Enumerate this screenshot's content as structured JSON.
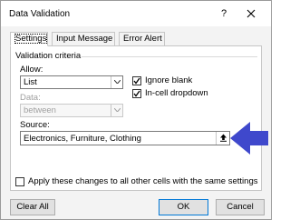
{
  "window": {
    "title": "Data Validation",
    "help_label": "?",
    "close_icon": "close-icon"
  },
  "tabs": [
    {
      "label": "Settings",
      "selected": true
    },
    {
      "label": "Input Message",
      "selected": false
    },
    {
      "label": "Error Alert",
      "selected": false
    }
  ],
  "criteria": {
    "section_label": "Validation criteria",
    "allow_label": "Allow:",
    "allow_value": "List",
    "data_label": "Data:",
    "data_value": "between",
    "data_enabled": false,
    "ignore_blank_label": "Ignore blank",
    "ignore_blank_checked": true,
    "in_cell_dropdown_label": "In-cell dropdown",
    "in_cell_dropdown_checked": true,
    "source_label": "Source:",
    "source_value": "Electronics, Furniture, Clothing",
    "collapse_icon": "collapse-dialog-icon"
  },
  "annotation": {
    "arrow_color": "#3f48cc",
    "arrow_icon": "pointer-arrow-icon"
  },
  "apply_all": {
    "label": "Apply these changes to all other cells with the same settings",
    "checked": false
  },
  "buttons": {
    "clear_all": "Clear All",
    "ok": "OK",
    "cancel": "Cancel"
  }
}
